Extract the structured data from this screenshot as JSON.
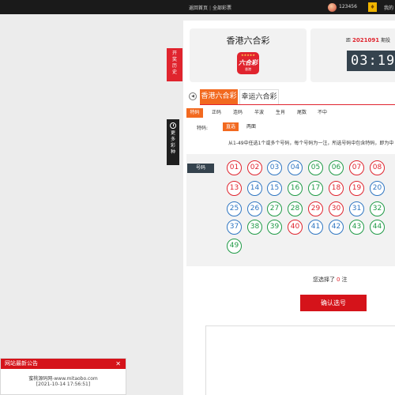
{
  "topbar": {
    "home": "返回首页",
    "separator": "|",
    "lotteries": "全部彩票",
    "user_id": "123456",
    "coin_icon": "coin-icon",
    "mine": "我的"
  },
  "lottery": {
    "name": "香港六合彩",
    "logo_stars": "★★★★★",
    "logo_main": "六合彩",
    "logo_sub": "香港"
  },
  "draw": {
    "prefix": "距",
    "issue": "2021091",
    "suffix": "期投",
    "countdown": "03:19"
  },
  "side": {
    "open_draw": [
      "开",
      "奖",
      "历",
      "史"
    ],
    "more_lottery": [
      "更",
      "多",
      "彩",
      "种"
    ]
  },
  "tabs": [
    "香港六合彩",
    "幸运六合彩"
  ],
  "playtypes": [
    "特码",
    "正码",
    "连码",
    "半波",
    "生肖",
    "尾数",
    "不中"
  ],
  "sub": {
    "label": "特码:",
    "options": [
      "直选",
      "两面"
    ]
  },
  "description": "从1-49中任选1个或多个号码，每个号码为一注，所选号码中包含特码，即为中",
  "number_label": "号码",
  "balls": [
    {
      "n": "01",
      "c": "red"
    },
    {
      "n": "02",
      "c": "red"
    },
    {
      "n": "03",
      "c": "blue"
    },
    {
      "n": "04",
      "c": "blue"
    },
    {
      "n": "05",
      "c": "green"
    },
    {
      "n": "06",
      "c": "green"
    },
    {
      "n": "07",
      "c": "red"
    },
    {
      "n": "08",
      "c": "red"
    },
    {
      "n": "13",
      "c": "red"
    },
    {
      "n": "14",
      "c": "blue"
    },
    {
      "n": "15",
      "c": "blue"
    },
    {
      "n": "16",
      "c": "green"
    },
    {
      "n": "17",
      "c": "green"
    },
    {
      "n": "18",
      "c": "red"
    },
    {
      "n": "19",
      "c": "red"
    },
    {
      "n": "20",
      "c": "blue"
    },
    {
      "n": "25",
      "c": "blue"
    },
    {
      "n": "26",
      "c": "blue"
    },
    {
      "n": "27",
      "c": "green"
    },
    {
      "n": "28",
      "c": "green"
    },
    {
      "n": "29",
      "c": "red"
    },
    {
      "n": "30",
      "c": "red"
    },
    {
      "n": "31",
      "c": "blue"
    },
    {
      "n": "32",
      "c": "green"
    },
    {
      "n": "37",
      "c": "blue"
    },
    {
      "n": "38",
      "c": "green"
    },
    {
      "n": "39",
      "c": "green"
    },
    {
      "n": "40",
      "c": "red"
    },
    {
      "n": "41",
      "c": "blue"
    },
    {
      "n": "42",
      "c": "blue"
    },
    {
      "n": "43",
      "c": "green"
    },
    {
      "n": "44",
      "c": "green"
    },
    {
      "n": "49",
      "c": "green"
    }
  ],
  "selected": {
    "prefix": "您选择了",
    "count": "0",
    "suffix": "注"
  },
  "confirm_label": "确认选号",
  "notice": {
    "title": "网站最新公告",
    "close": "✕",
    "line1": "蜜桃源码网-www.mitaobo.com",
    "line2": "[2021-10-14 17:56:51]"
  },
  "colors": {
    "accent": "#f2691f",
    "brand_red": "#e0242e",
    "ball_red": "#e0242e",
    "ball_blue": "#2f76c2",
    "ball_green": "#1f9a46"
  }
}
